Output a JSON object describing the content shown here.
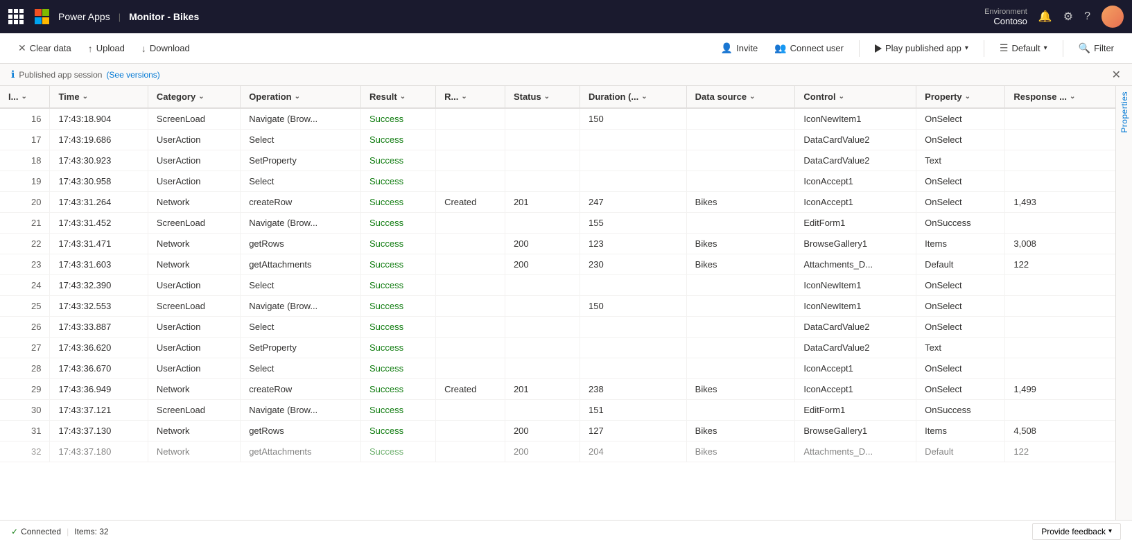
{
  "titleBar": {
    "appName": "Power Apps",
    "separator": "|",
    "monitorTitle": "Monitor - Bikes",
    "environment": {
      "label": "Environment",
      "name": "Contoso"
    }
  },
  "toolbar": {
    "clearData": "Clear data",
    "upload": "Upload",
    "download": "Download",
    "invite": "Invite",
    "connectUser": "Connect user",
    "playPublishedApp": "Play published app",
    "default": "Default",
    "filter": "Filter"
  },
  "infoBar": {
    "message": "Published app session",
    "linkText": "(See versions)"
  },
  "columns": [
    {
      "id": "id",
      "label": "I..."
    },
    {
      "id": "time",
      "label": "Time"
    },
    {
      "id": "category",
      "label": "Category"
    },
    {
      "id": "operation",
      "label": "Operation"
    },
    {
      "id": "result",
      "label": "Result"
    },
    {
      "id": "r",
      "label": "R..."
    },
    {
      "id": "status",
      "label": "Status"
    },
    {
      "id": "duration",
      "label": "Duration (..."
    },
    {
      "id": "datasource",
      "label": "Data source"
    },
    {
      "id": "control",
      "label": "Control"
    },
    {
      "id": "property",
      "label": "Property"
    },
    {
      "id": "response",
      "label": "Response ..."
    }
  ],
  "rows": [
    {
      "id": 16,
      "time": "17:43:18.904",
      "category": "ScreenLoad",
      "operation": "Navigate (Brow...",
      "result": "Success",
      "r": "",
      "status": "",
      "duration": 150,
      "datasource": "",
      "control": "IconNewItem1",
      "property": "OnSelect",
      "response": ""
    },
    {
      "id": 17,
      "time": "17:43:19.686",
      "category": "UserAction",
      "operation": "Select",
      "result": "Success",
      "r": "",
      "status": "",
      "duration": "",
      "datasource": "",
      "control": "DataCardValue2",
      "property": "OnSelect",
      "response": ""
    },
    {
      "id": 18,
      "time": "17:43:30.923",
      "category": "UserAction",
      "operation": "SetProperty",
      "result": "Success",
      "r": "",
      "status": "",
      "duration": "",
      "datasource": "",
      "control": "DataCardValue2",
      "property": "Text",
      "response": ""
    },
    {
      "id": 19,
      "time": "17:43:30.958",
      "category": "UserAction",
      "operation": "Select",
      "result": "Success",
      "r": "",
      "status": "",
      "duration": "",
      "datasource": "",
      "control": "IconAccept1",
      "property": "OnSelect",
      "response": ""
    },
    {
      "id": 20,
      "time": "17:43:31.264",
      "category": "Network",
      "operation": "createRow",
      "result": "Success",
      "r": "Created",
      "status": 201,
      "duration": 247,
      "datasource": "Bikes",
      "control": "IconAccept1",
      "property": "OnSelect",
      "response": "1,493"
    },
    {
      "id": 21,
      "time": "17:43:31.452",
      "category": "ScreenLoad",
      "operation": "Navigate (Brow...",
      "result": "Success",
      "r": "",
      "status": "",
      "duration": 155,
      "datasource": "",
      "control": "EditForm1",
      "property": "OnSuccess",
      "response": ""
    },
    {
      "id": 22,
      "time": "17:43:31.471",
      "category": "Network",
      "operation": "getRows",
      "result": "Success",
      "r": "",
      "status": 200,
      "duration": 123,
      "datasource": "Bikes",
      "control": "BrowseGallery1",
      "property": "Items",
      "response": "3,008"
    },
    {
      "id": 23,
      "time": "17:43:31.603",
      "category": "Network",
      "operation": "getAttachments",
      "result": "Success",
      "r": "",
      "status": 200,
      "duration": 230,
      "datasource": "Bikes",
      "control": "Attachments_D...",
      "property": "Default",
      "response": "122"
    },
    {
      "id": 24,
      "time": "17:43:32.390",
      "category": "UserAction",
      "operation": "Select",
      "result": "Success",
      "r": "",
      "status": "",
      "duration": "",
      "datasource": "",
      "control": "IconNewItem1",
      "property": "OnSelect",
      "response": ""
    },
    {
      "id": 25,
      "time": "17:43:32.553",
      "category": "ScreenLoad",
      "operation": "Navigate (Brow...",
      "result": "Success",
      "r": "",
      "status": "",
      "duration": 150,
      "datasource": "",
      "control": "IconNewItem1",
      "property": "OnSelect",
      "response": ""
    },
    {
      "id": 26,
      "time": "17:43:33.887",
      "category": "UserAction",
      "operation": "Select",
      "result": "Success",
      "r": "",
      "status": "",
      "duration": "",
      "datasource": "",
      "control": "DataCardValue2",
      "property": "OnSelect",
      "response": ""
    },
    {
      "id": 27,
      "time": "17:43:36.620",
      "category": "UserAction",
      "operation": "SetProperty",
      "result": "Success",
      "r": "",
      "status": "",
      "duration": "",
      "datasource": "",
      "control": "DataCardValue2",
      "property": "Text",
      "response": ""
    },
    {
      "id": 28,
      "time": "17:43:36.670",
      "category": "UserAction",
      "operation": "Select",
      "result": "Success",
      "r": "",
      "status": "",
      "duration": "",
      "datasource": "",
      "control": "IconAccept1",
      "property": "OnSelect",
      "response": ""
    },
    {
      "id": 29,
      "time": "17:43:36.949",
      "category": "Network",
      "operation": "createRow",
      "result": "Success",
      "r": "Created",
      "status": 201,
      "duration": 238,
      "datasource": "Bikes",
      "control": "IconAccept1",
      "property": "OnSelect",
      "response": "1,499"
    },
    {
      "id": 30,
      "time": "17:43:37.121",
      "category": "ScreenLoad",
      "operation": "Navigate (Brow...",
      "result": "Success",
      "r": "",
      "status": "",
      "duration": 151,
      "datasource": "",
      "control": "EditForm1",
      "property": "OnSuccess",
      "response": ""
    },
    {
      "id": 31,
      "time": "17:43:37.130",
      "category": "Network",
      "operation": "getRows",
      "result": "Success",
      "r": "",
      "status": 200,
      "duration": 127,
      "datasource": "Bikes",
      "control": "BrowseGallery1",
      "property": "Items",
      "response": "4,508"
    },
    {
      "id": 32,
      "time": "17:43:37.180",
      "category": "Network",
      "operation": "getAttachments",
      "result": "Success",
      "r": "",
      "status": 200,
      "duration": 204,
      "datasource": "Bikes",
      "control": "Attachments_D...",
      "property": "Default",
      "response": "122"
    }
  ],
  "sidePanel": {
    "label": "Properties"
  },
  "statusBar": {
    "connected": "Connected",
    "items": "Items: 32",
    "feedback": "Provide feedback"
  }
}
